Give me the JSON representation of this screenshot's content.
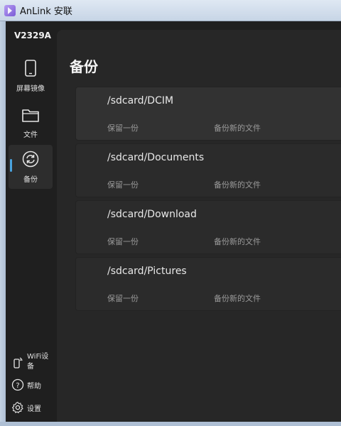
{
  "window": {
    "title": "AnLink 安联"
  },
  "sidebar": {
    "device": "V2329A",
    "items": [
      {
        "label": "屏幕镜像",
        "icon": "phone-icon"
      },
      {
        "label": "文件",
        "icon": "folder-icon"
      },
      {
        "label": "备份",
        "icon": "sync-icon"
      }
    ],
    "active": "备份",
    "bottom": [
      {
        "label": "WiFi设备",
        "icon": "wifi-phone-icon"
      },
      {
        "label": "帮助",
        "icon": "help-icon"
      },
      {
        "label": "设置",
        "icon": "gear-icon"
      }
    ]
  },
  "main": {
    "title": "备份",
    "cards": [
      {
        "path": "/sdcard/DCIM",
        "keep": "保留一份",
        "mode": "备份新的文件"
      },
      {
        "path": "/sdcard/Documents",
        "keep": "保留一份",
        "mode": "备份新的文件"
      },
      {
        "path": "/sdcard/Download",
        "keep": "保留一份",
        "mode": "备份新的文件"
      },
      {
        "path": "/sdcard/Pictures",
        "keep": "保留一份",
        "mode": "备份新的文件"
      }
    ]
  },
  "colors": {
    "accent": "#4aa3df",
    "background": "#1f1f1f",
    "panel": "#272727"
  }
}
